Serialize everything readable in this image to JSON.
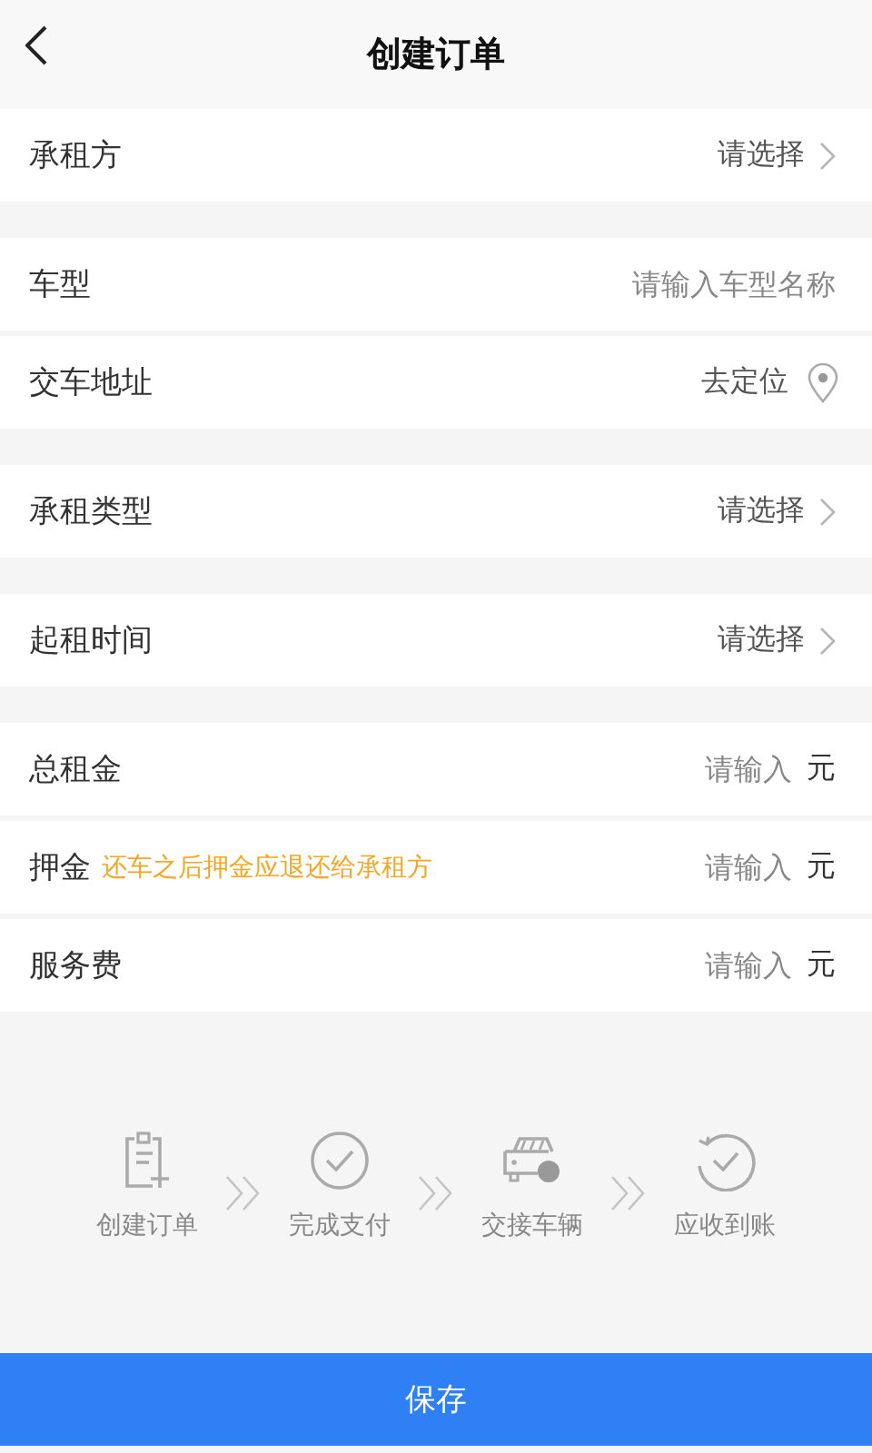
{
  "header": {
    "title": "创建订单"
  },
  "groups": [
    {
      "rows": [
        {
          "kind": "select",
          "label": "承租方",
          "value": "请选择"
        }
      ]
    },
    {
      "rows": [
        {
          "kind": "input",
          "label": "车型",
          "placeholder": "请输入车型名称"
        },
        {
          "kind": "location",
          "label": "交车地址",
          "value": "去定位"
        }
      ]
    },
    {
      "rows": [
        {
          "kind": "select",
          "label": "承租类型",
          "value": "请选择"
        }
      ]
    },
    {
      "rows": [
        {
          "kind": "select",
          "label": "起租时间",
          "value": "请选择"
        }
      ]
    },
    {
      "rows": [
        {
          "kind": "money",
          "label": "总租金",
          "placeholder": "请输入",
          "unit": "元"
        },
        {
          "kind": "money",
          "label": "押金",
          "note": "还车之后押金应退还给承租方",
          "placeholder": "请输入",
          "unit": "元"
        },
        {
          "kind": "money",
          "label": "服务费",
          "placeholder": "请输入",
          "unit": "元"
        }
      ]
    }
  ],
  "steps": [
    {
      "label": "创建订单"
    },
    {
      "label": "完成支付"
    },
    {
      "label": "交接车辆"
    },
    {
      "label": "应收到账"
    }
  ],
  "save_button": "保存"
}
